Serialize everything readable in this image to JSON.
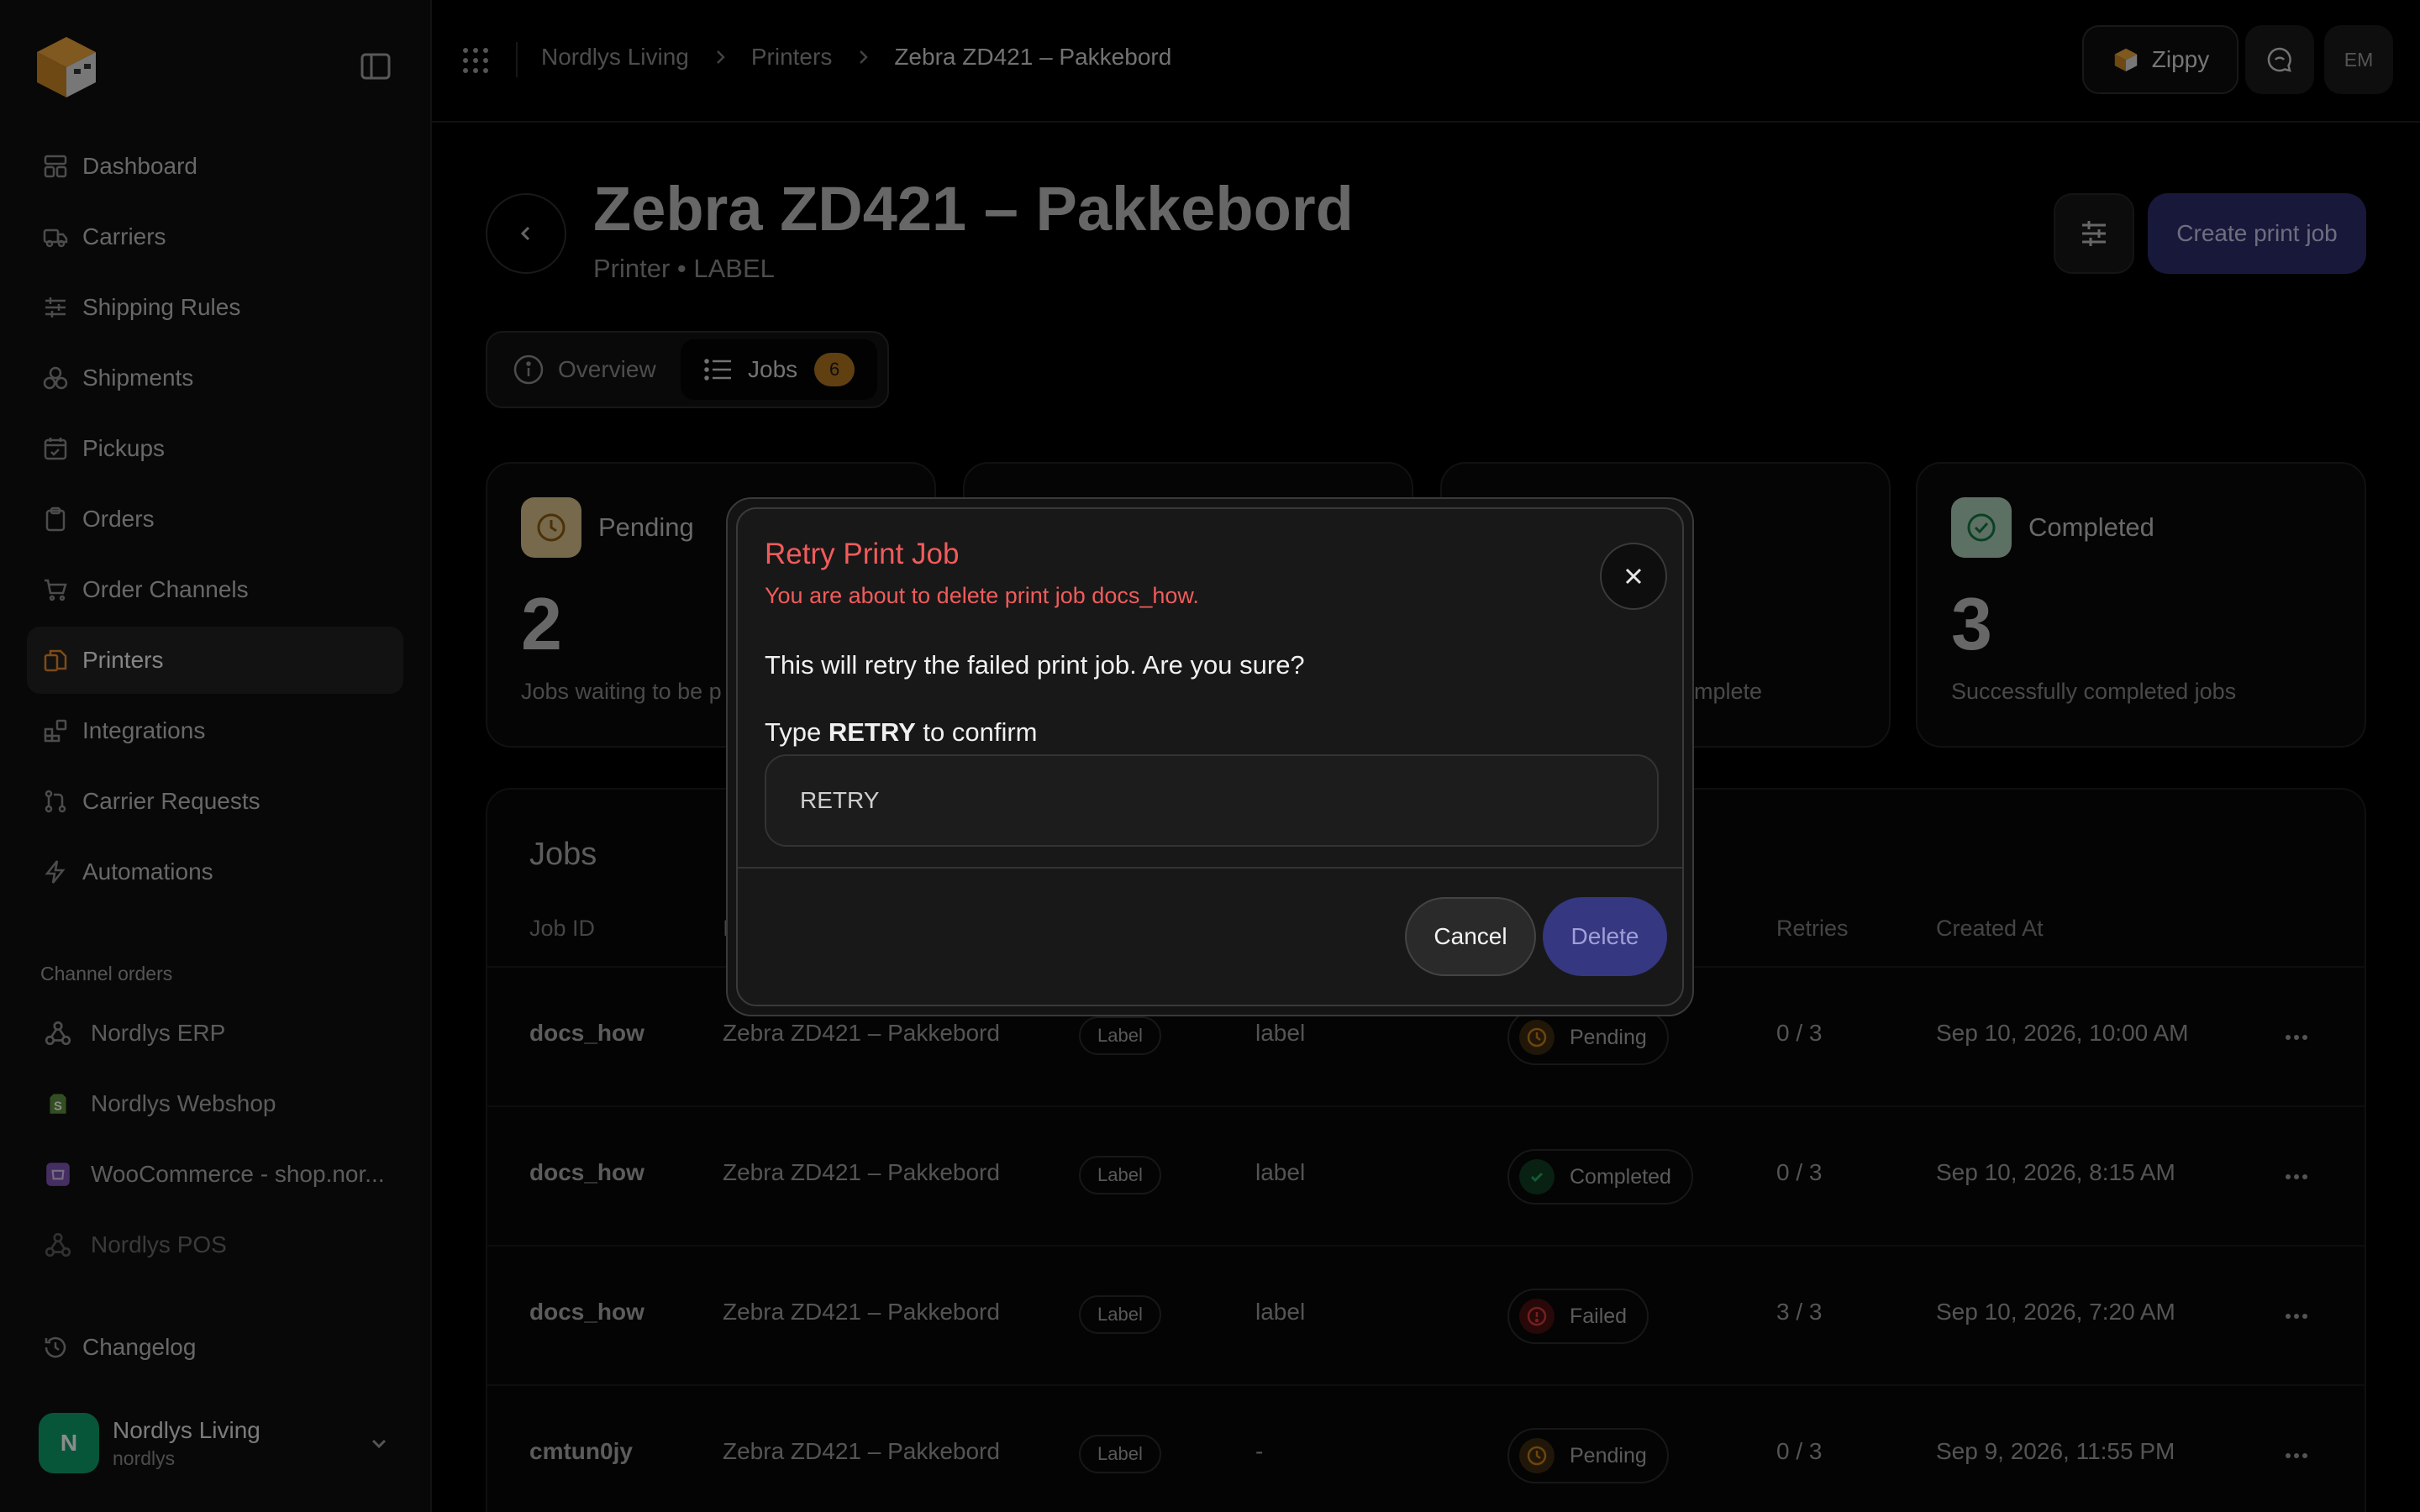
{
  "sidebar": {
    "nav": [
      {
        "label": "Dashboard",
        "icon": "dashboard-icon"
      },
      {
        "label": "Carriers",
        "icon": "truck-icon"
      },
      {
        "label": "Shipping Rules",
        "icon": "sliders-icon"
      },
      {
        "label": "Shipments",
        "icon": "boxes-icon"
      },
      {
        "label": "Pickups",
        "icon": "calendar-icon"
      },
      {
        "label": "Orders",
        "icon": "clipboard-icon"
      },
      {
        "label": "Order Channels",
        "icon": "cart-icon"
      },
      {
        "label": "Printers",
        "icon": "printer-icon",
        "active": true
      },
      {
        "label": "Integrations",
        "icon": "blocks-icon"
      },
      {
        "label": "Carrier Requests",
        "icon": "git-pull-icon"
      },
      {
        "label": "Automations",
        "icon": "bolt-icon"
      }
    ],
    "channels_label": "Channel orders",
    "channels": [
      {
        "label": "Nordlys ERP",
        "icon": "webhook-icon"
      },
      {
        "label": "Nordlys Webshop",
        "icon": "shopify-icon"
      },
      {
        "label": "WooCommerce - shop.nor...",
        "icon": "woocommerce-icon"
      },
      {
        "label": "Nordlys POS",
        "icon": "webhook-icon"
      }
    ],
    "changelog": "Changelog",
    "workspace": {
      "initial": "N",
      "name": "Nordlys Living",
      "slug": "nordlys"
    }
  },
  "topbar": {
    "breadcrumb": [
      "Nordlys Living",
      "Printers",
      "Zebra ZD421 – Pakkebord"
    ],
    "zippy_label": "Zippy",
    "user_initials": "EM"
  },
  "header": {
    "title": "Zebra ZD421 – Pakkebord",
    "subtitle": "Printer • LABEL",
    "create_label": "Create print job"
  },
  "tabs": {
    "overview": "Overview",
    "jobs": "Jobs",
    "jobs_count": "6"
  },
  "stats": {
    "pending": {
      "label": "Pending",
      "value": "2",
      "desc": "Jobs waiting to be p"
    },
    "failed_partial": {
      "desc": "mplete"
    },
    "completed": {
      "label": "Completed",
      "value": "3",
      "desc": "Successfully completed jobs"
    }
  },
  "jobs": {
    "title": "Jobs",
    "headers": {
      "job_id": "Job ID",
      "printer_partial": "I",
      "retries": "Retries",
      "created_at": "Created At"
    },
    "rows": [
      {
        "job_id": "docs_how",
        "printer": "Zebra ZD421 – Pakkebord",
        "type": "Label",
        "content": "label",
        "status": "Pending",
        "retries": "0 / 3",
        "created": "Sep 10, 2026, 10:00 AM"
      },
      {
        "job_id": "docs_how",
        "printer": "Zebra ZD421 – Pakkebord",
        "type": "Label",
        "content": "label",
        "status": "Completed",
        "retries": "0 / 3",
        "created": "Sep 10, 2026, 8:15 AM"
      },
      {
        "job_id": "docs_how",
        "printer": "Zebra ZD421 – Pakkebord",
        "type": "Label",
        "content": "label",
        "status": "Failed",
        "retries": "3 / 3",
        "created": "Sep 10, 2026, 7:20 AM"
      },
      {
        "job_id": "cmtun0jy",
        "printer": "Zebra ZD421 – Pakkebord",
        "type": "Label",
        "content": "-",
        "status": "Pending",
        "retries": "0 / 3",
        "created": "Sep 9, 2026, 11:55 PM"
      }
    ]
  },
  "modal": {
    "title": "Retry Print Job",
    "subtitle": "You are about to delete print job docs_how.",
    "body": "This will retry the failed print job. Are you sure?",
    "confirm_prefix": "Type",
    "confirm_keyword": "RETRY",
    "confirm_suffix": "to confirm",
    "input_value": "RETRY",
    "cancel_label": "Cancel",
    "delete_label": "Delete"
  },
  "colors": {
    "accent": "#e8892a",
    "primary_button": "#2c2d6a",
    "danger_text": "#f15b5b",
    "pending": "#b0761f",
    "completed": "#1f9d55",
    "failed": "#c0392b"
  }
}
